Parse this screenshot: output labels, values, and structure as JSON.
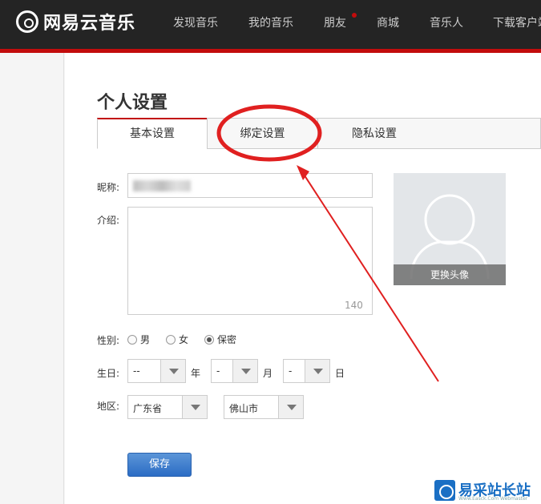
{
  "header": {
    "logo_text": "网易云音乐",
    "nav": [
      "发现音乐",
      "我的音乐",
      "朋友",
      "商城",
      "音乐人",
      "下载客户端"
    ]
  },
  "page": {
    "title": "个人设置",
    "tabs": [
      "基本设置",
      "绑定设置",
      "隐私设置"
    ],
    "active_tab": "基本设置"
  },
  "form": {
    "nickname_label": "昵称:",
    "intro_label": "介绍:",
    "intro_counter": "140",
    "gender_label": "性别:",
    "gender_options": [
      "男",
      "女",
      "保密"
    ],
    "gender_selected": "保密",
    "birthday_label": "生日:",
    "birthday": {
      "year": "--",
      "year_unit": "年",
      "month": "-",
      "month_unit": "月",
      "day": "-",
      "day_unit": "日"
    },
    "region_label": "地区:",
    "province": "广东省",
    "city": "佛山市",
    "save_label": "保存"
  },
  "avatar": {
    "change_label": "更换头像"
  },
  "watermark": {
    "text": "易采站长站",
    "subtext": "Www.Easck.Com Webmaster"
  },
  "colors": {
    "brand_red": "#c20c0c",
    "topbar": "#242424",
    "annotation": "#e02020",
    "button_blue": "#2b6cc4"
  }
}
